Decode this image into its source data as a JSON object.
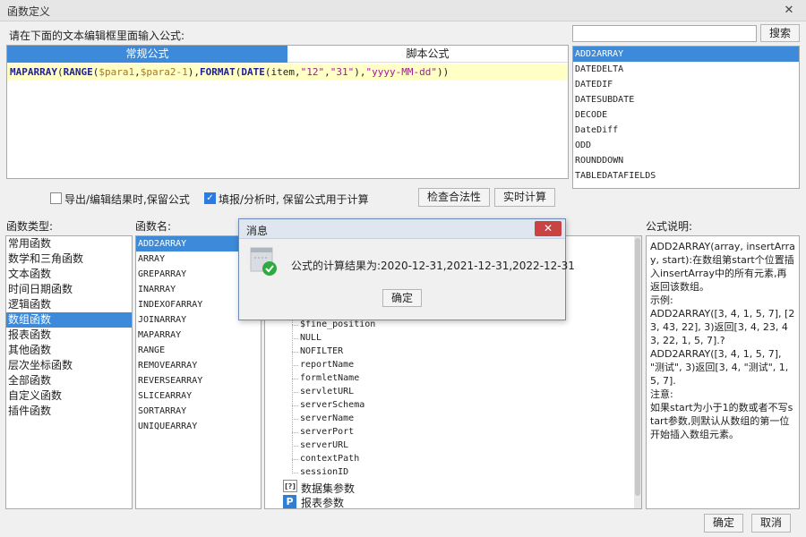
{
  "window": {
    "title": "函数定义",
    "close_icon": "close-icon"
  },
  "editor": {
    "instruction": "请在下面的文本编辑框里面输入公式:",
    "tabs": [
      {
        "label": "常规公式",
        "active": true
      },
      {
        "label": "脚本公式",
        "active": false
      }
    ],
    "formula_tokens": [
      {
        "t": "MAPARRAY",
        "c": "kw"
      },
      {
        "t": "(",
        "c": ""
      },
      {
        "t": "RANGE",
        "c": "kw"
      },
      {
        "t": "(",
        "c": ""
      },
      {
        "t": "$para1",
        "c": "pv"
      },
      {
        "t": ",",
        "c": ""
      },
      {
        "t": "$para2-1",
        "c": "pv"
      },
      {
        "t": "),",
        "c": ""
      },
      {
        "t": "FORMAT",
        "c": "kw"
      },
      {
        "t": "(",
        "c": ""
      },
      {
        "t": "DATE",
        "c": "kw"
      },
      {
        "t": "(item,",
        "c": ""
      },
      {
        "t": "\"12\"",
        "c": "st"
      },
      {
        "t": ",",
        "c": ""
      },
      {
        "t": "\"31\"",
        "c": "st"
      },
      {
        "t": "),",
        "c": ""
      },
      {
        "t": "\"yyyy-MM-dd\"",
        "c": "st"
      },
      {
        "t": "))",
        "c": ""
      }
    ]
  },
  "search": {
    "value": "",
    "button_label": "搜索"
  },
  "search_results": {
    "items": [
      "ADD2ARRAY",
      "DATEDELTA",
      "DATEDIF",
      "DATESUBDATE",
      "DECODE",
      "DateDiff",
      "ODD",
      "ROUNDDOWN",
      "TABLEDATAFIELDS"
    ],
    "selected_index": 0
  },
  "options": {
    "export_keep_formula": {
      "label": "导出/编辑结果时,保留公式",
      "checked": false
    },
    "fill_keep_formula": {
      "label": "填报/分析时, 保留公式用于计算",
      "checked": true
    },
    "check_validity_label": "检查合法性",
    "realtime_calc_label": "实时计算"
  },
  "function_types": {
    "header": "函数类型:",
    "items": [
      "常用函数",
      "数学和三角函数",
      "文本函数",
      "时间日期函数",
      "逻辑函数",
      "数组函数",
      "报表函数",
      "其他函数",
      "层次坐标函数",
      "全部函数",
      "自定义函数",
      "插件函数"
    ],
    "selected_index": 5
  },
  "function_names": {
    "header": "函数名:",
    "items": [
      "ADD2ARRAY",
      "ARRAY",
      "GREPARRAY",
      "INARRAY",
      "INDEXOFARRAY",
      "JOINARRAY",
      "MAPARRAY",
      "RANGE",
      "REMOVEARRAY",
      "REVERSEARRAY",
      "SLICEARRAY",
      "SORTARRAY",
      "UNIQUEARRAY"
    ],
    "selected_index": 0
  },
  "params_tree": {
    "items": [
      "$fine_position",
      "NULL",
      "NOFILTER",
      "reportName",
      "formletName",
      "servletURL",
      "serverSchema",
      "serverName",
      "serverPort",
      "serverURL",
      "contextPath",
      "sessionID"
    ],
    "dataset_params_label": "数据集参数",
    "report_params_label": "报表参数"
  },
  "description": {
    "header": "公式说明:",
    "lines": [
      "ADD2ARRAY(array, insertArray, start):在数组第start个位置插入insertArray中的所有元素,再返回该数组。",
      "示例:",
      "ADD2ARRAY([3, 4, 1, 5, 7], [23, 43, 22], 3)返回[3, 4, 23, 43, 22, 1, 5, 7].?",
      "ADD2ARRAY([3, 4, 1, 5, 7], \"测试\", 3)返回[3, 4, \"测试\", 1, 5, 7].",
      "注意:",
      "如果start为小于1的数或者不写start参数,则默认从数组的第一位开始插入数组元素。"
    ]
  },
  "footer": {
    "ok_label": "确定",
    "cancel_label": "取消"
  },
  "message_dialog": {
    "title": "消息",
    "message": "公式的计算结果为:2020-12-31,2021-12-31,2022-12-31",
    "ok_label": "确定"
  }
}
